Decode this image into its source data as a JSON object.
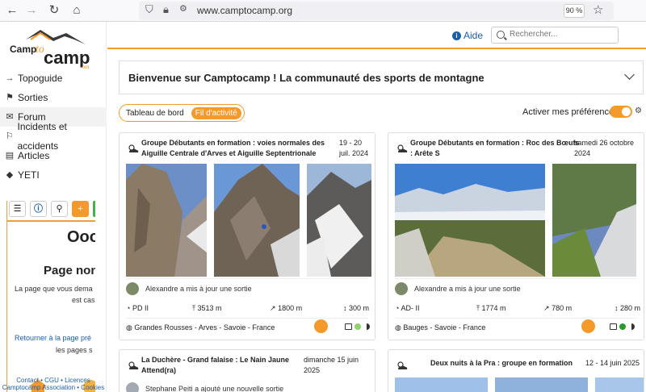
{
  "browser": {
    "url": "www.camptocamp.org",
    "zoom": "90 %",
    "back_icon": "arrow-left-icon",
    "forward_icon": "arrow-right-icon",
    "reload_icon": "reload-icon",
    "home_icon": "home-icon"
  },
  "brand": {
    "accent": "#f39a2a",
    "link": "#1a5ea8"
  },
  "sidebar": {
    "items": [
      {
        "label": "Topoguide",
        "icon": "arrow-right-icon",
        "glyph": "→"
      },
      {
        "label": "Sorties",
        "icon": "flag-icon",
        "glyph": "⚑"
      },
      {
        "label": "Forum",
        "icon": "comments-icon",
        "glyph": "✉"
      },
      {
        "label": "Incidents et accidents",
        "icon": "flag-outline-icon",
        "glyph": "⚐"
      },
      {
        "label": "Articles",
        "icon": "newspaper-icon",
        "glyph": "▤"
      },
      {
        "label": "YETI",
        "icon": "diamond-icon",
        "glyph": "◆"
      }
    ],
    "mini": {
      "big": "Ooo",
      "heading": "Page non",
      "p1": "La page que vous dema",
      "p2": "est cas",
      "link1": "Retourner à la page pré",
      "link2": "les pages s"
    },
    "footer1": "Contact • CGU • Licences",
    "footer2": "Camptocamp Association • Cookies"
  },
  "header": {
    "help_label": "Aide",
    "search_placeholder": "Rechercher..."
  },
  "welcome": {
    "title": "Bienvenue sur Camptocamp ! La communauté des sports de montagne"
  },
  "tabs": [
    {
      "label": "Tableau de bord"
    },
    {
      "label": "Fil d'activité"
    }
  ],
  "prefs_label": "Activer mes préférences",
  "cards": [
    {
      "title1": "Groupe Débutants en formation : voies normales des",
      "title2": "Aiguille Centrale d'Arves et Aiguille Septentrionale",
      "date1": "19 - 20",
      "date2": "juil. 2024",
      "author": "Alexandre",
      "action": "a mis à jour une sortie",
      "grade": "PD II",
      "elevation": "3513 m",
      "height_diff": "1800 m",
      "height": "300 m",
      "region": "Grandes Rousses - Arves - Savoie - France"
    },
    {
      "title1": "Groupe Débutants en formation : Roc des Bœufs",
      "title2": ": Arête S",
      "date1": "samedi 26 octobre",
      "date2": "2024",
      "author": "Alexandre",
      "action": "a mis à jour une sortie",
      "grade": "AD- II",
      "elevation": "1774 m",
      "height_diff": "780 m",
      "height": "280 m",
      "region": "Bauges - Savoie - France"
    },
    {
      "title1": "La Duchère - Grand falaise : Le Nain Jaune",
      "title2": "Attend(ra)",
      "date1": "dimanche 15 juin",
      "date2": "2025",
      "author": "Stephane Peiti",
      "action": "a ajouté une nouvelle sortie"
    },
    {
      "title1": "Deux nuits à la Pra : groupe en formation",
      "date1": "12 - 14 juin 2025"
    }
  ]
}
